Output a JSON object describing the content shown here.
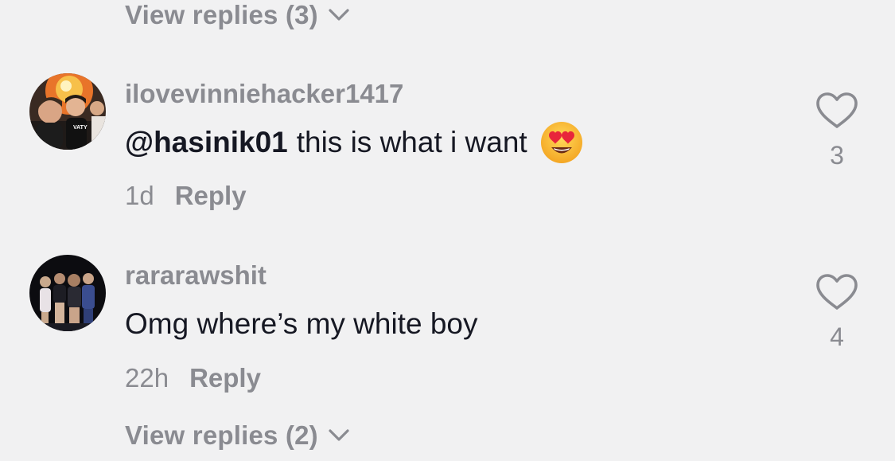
{
  "top_view_replies": {
    "label": "View replies (3)"
  },
  "comments": [
    {
      "username": "ilovevinniehacker1417",
      "mention": "@hasinik01",
      "text": "this is what i want",
      "emoji": "heart-eyes-emoji",
      "time": "1d",
      "reply_label": "Reply",
      "likes": "3"
    },
    {
      "username": "rararawshit",
      "mention": "",
      "text": "Omg where’s my white boy",
      "emoji": "",
      "time": "22h",
      "reply_label": "Reply",
      "likes": "4"
    }
  ],
  "bottom_view_replies": {
    "label": "View replies (2)"
  },
  "colors": {
    "background": "#f1f1f2",
    "primary_text": "#161823",
    "secondary_text": "#8a8b91"
  }
}
